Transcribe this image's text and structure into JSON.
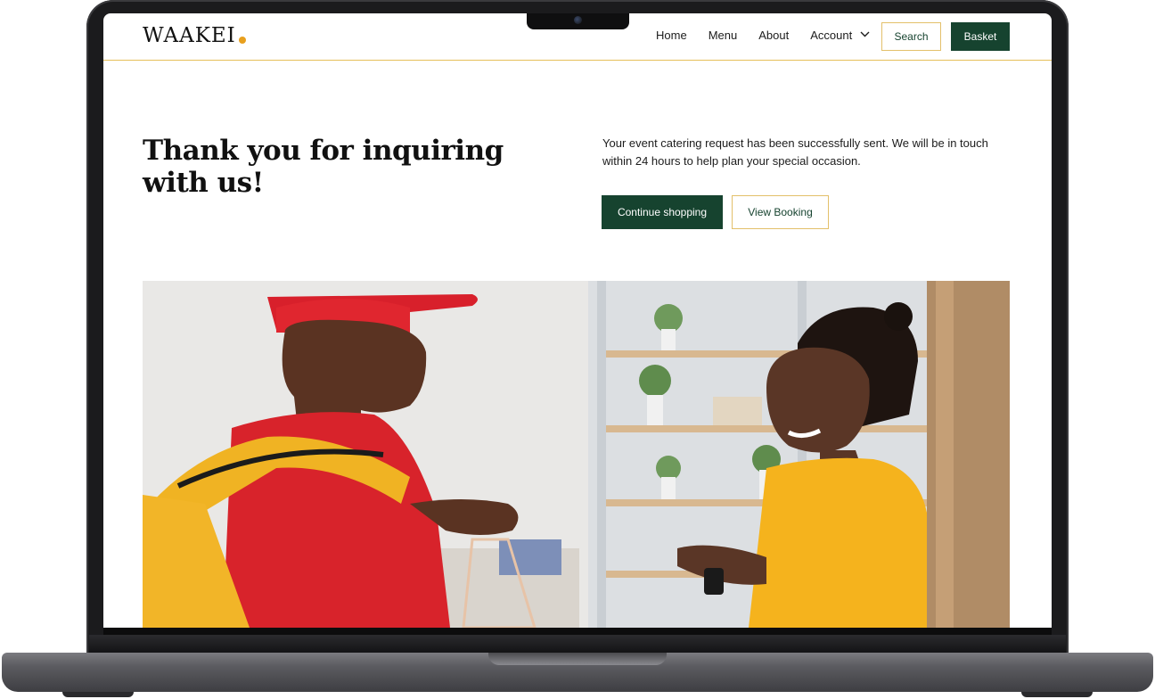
{
  "brand": {
    "logo": "WAAKEI",
    "accent_color": "#e8a01e",
    "primary_color": "#16432f",
    "border_color": "#e3c06a"
  },
  "nav": {
    "links": [
      "Home",
      "Menu",
      "About",
      "Account"
    ],
    "account_icon": "chevron-down-icon",
    "search_label": "Search",
    "basket_label": "Basket"
  },
  "hero": {
    "title": "Thank you for inquiring with us!",
    "body": "Your event catering request has been successfully sent. We will be in touch within 24 hours to help plan your special occasion.",
    "primary_button": "Continue shopping",
    "secondary_button": "View Booking"
  }
}
